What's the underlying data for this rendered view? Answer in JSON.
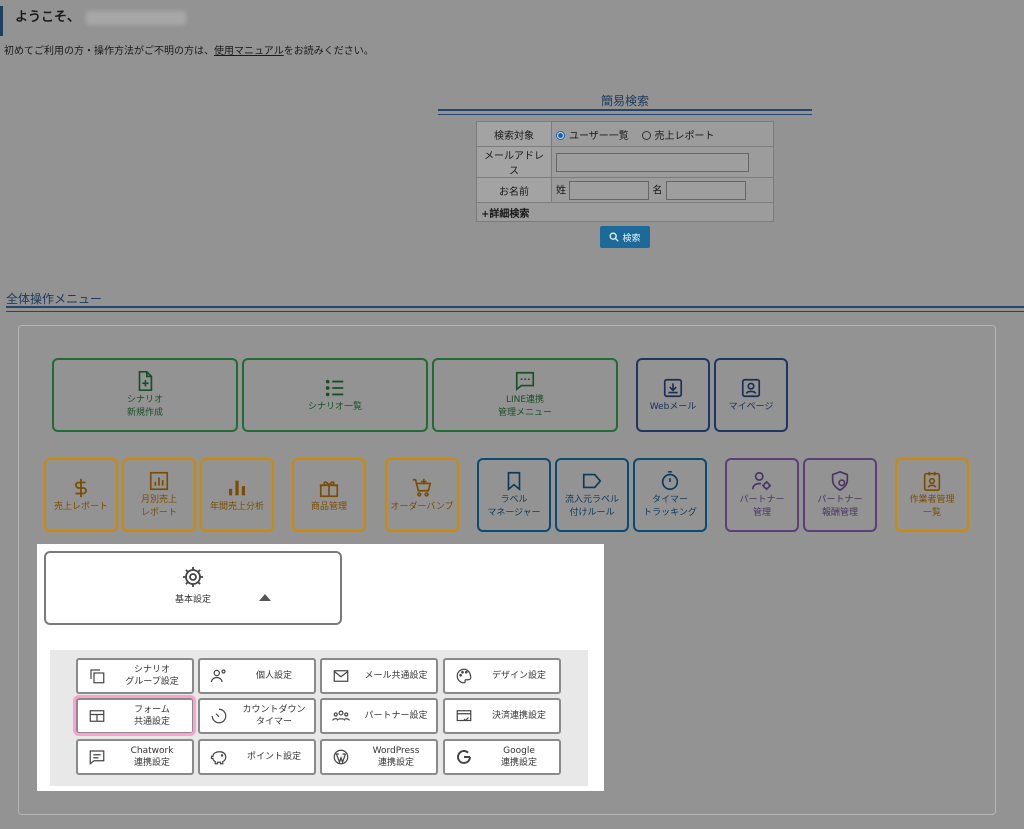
{
  "header": {
    "welcome": "ようこそ、",
    "intro_before": "初めてご利用の方・操作方法がご不明の方は、",
    "intro_link": "使用マニュアル",
    "intro_after": "をお読みください。"
  },
  "quick_search": {
    "title": "簡易検索",
    "target_label": "検索対象",
    "target_options": [
      "ユーザー一覧",
      "売上レポート"
    ],
    "target_selected": "ユーザー一覧",
    "email_label": "メールアドレス",
    "email_value": "",
    "name_label": "お名前",
    "last_name_label": "姓",
    "first_name_label": "名",
    "last_name_value": "",
    "first_name_value": "",
    "advanced": "+詳細検索",
    "search_button": "検索"
  },
  "menu": {
    "title": "全体操作メニュー",
    "row1": [
      {
        "line1": "シナリオ",
        "line2": "新規作成",
        "icon": "file-plus-icon"
      },
      {
        "line1": "シナリオ一覧",
        "line2": "",
        "icon": "list-icon"
      },
      {
        "line1": "LINE連携",
        "line2": "管理メニュー",
        "icon": "chat-icon"
      },
      {
        "line1": "Webメール",
        "line2": "",
        "icon": "download-icon"
      },
      {
        "line1": "マイページ",
        "line2": "",
        "icon": "portrait-icon"
      }
    ],
    "row2": [
      {
        "line1": "売上レポート",
        "line2": "",
        "icon": "dollar-icon"
      },
      {
        "line1": "月別売上",
        "line2": "レポート",
        "icon": "chart-box-icon"
      },
      {
        "line1": "年間売上分析",
        "line2": "",
        "icon": "bar-chart-icon"
      },
      {
        "line1": "商品管理",
        "line2": "",
        "icon": "gift-icon"
      },
      {
        "line1": "オーダーバンプ",
        "line2": "",
        "icon": "cart-plus-icon"
      },
      {
        "line1": "ラベル",
        "line2": "マネージャー",
        "icon": "bookmark-icon"
      },
      {
        "line1": "流入元ラベル",
        "line2": "付けルール",
        "icon": "tag-icon"
      },
      {
        "line1": "タイマー",
        "line2": "トラッキング",
        "icon": "timer-icon"
      },
      {
        "line1": "パートナー",
        "line2": "管理",
        "icon": "user-gear-icon"
      },
      {
        "line1": "パートナー",
        "line2": "報酬管理",
        "icon": "shield-user-icon"
      },
      {
        "line1": "作業者管理",
        "line2": "一覧",
        "icon": "id-badge-icon"
      }
    ],
    "basic_settings": "基本設定",
    "sub": [
      {
        "line1": "シナリオ",
        "line2": "グループ設定",
        "icon": "copy-icon"
      },
      {
        "line1": "個人設定",
        "line2": "",
        "icon": "person-settings-icon"
      },
      {
        "line1": "メール共通設定",
        "line2": "",
        "icon": "mail-icon"
      },
      {
        "line1": "デザイン設定",
        "line2": "",
        "icon": "palette-icon"
      },
      {
        "line1": "フォーム",
        "line2": "共通設定",
        "icon": "form-icon"
      },
      {
        "line1": "カウントダウン",
        "line2": "タイマー",
        "icon": "countdown-icon"
      },
      {
        "line1": "パートナー設定",
        "line2": "",
        "icon": "group-icon"
      },
      {
        "line1": "決済連携設定",
        "line2": "",
        "icon": "card-check-icon"
      },
      {
        "line1": "Chatwork",
        "line2": "連携設定",
        "icon": "chatwork-icon"
      },
      {
        "line1": "ポイント設定",
        "line2": "",
        "icon": "piggy-bank-icon"
      },
      {
        "line1": "WordPress",
        "line2": "連携設定",
        "icon": "wordpress-icon"
      },
      {
        "line1": "Google",
        "line2": "連携設定",
        "icon": "google-icon"
      }
    ]
  },
  "colors": {
    "green": "#216c34",
    "navy": "#1f3561",
    "orange": "#d08a00",
    "teal": "#0b4a73",
    "purple": "#5b3f76",
    "highlight": "#ff9fcf",
    "search_button": "#1b6a9a"
  }
}
